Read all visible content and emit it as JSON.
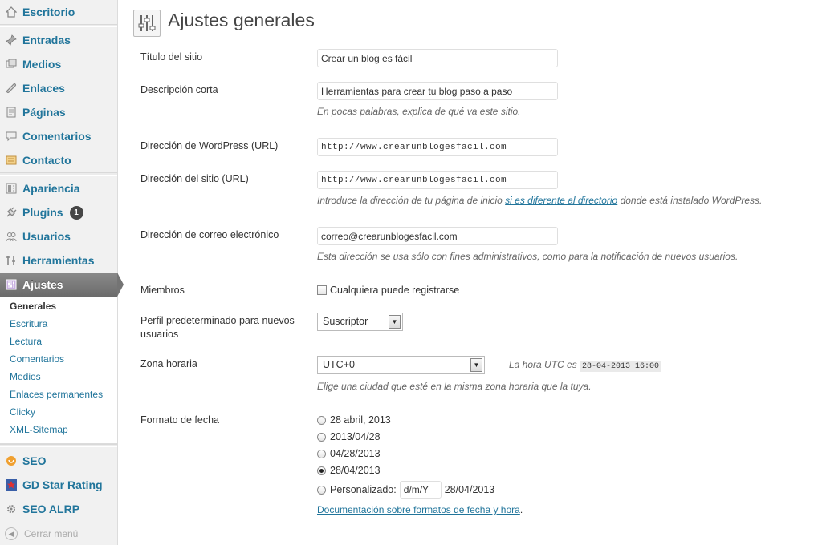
{
  "sidebar": {
    "items": [
      {
        "label": "Escritorio",
        "icon": "home-icon"
      },
      {
        "label": "Entradas",
        "icon": "pin-icon"
      },
      {
        "label": "Medios",
        "icon": "media-icon"
      },
      {
        "label": "Enlaces",
        "icon": "link-icon"
      },
      {
        "label": "Páginas",
        "icon": "page-icon"
      },
      {
        "label": "Comentarios",
        "icon": "comment-icon"
      },
      {
        "label": "Contacto",
        "icon": "contact-icon"
      },
      {
        "label": "Apariencia",
        "icon": "appearance-icon"
      },
      {
        "label": "Plugins",
        "icon": "plugin-icon",
        "badge": "1"
      },
      {
        "label": "Usuarios",
        "icon": "users-icon"
      },
      {
        "label": "Herramientas",
        "icon": "tools-icon"
      },
      {
        "label": "Ajustes",
        "icon": "settings-icon"
      },
      {
        "label": "SEO",
        "icon": "seo-icon"
      },
      {
        "label": "GD Star Rating",
        "icon": "star-icon"
      },
      {
        "label": "SEO ALRP",
        "icon": "gear-icon"
      }
    ],
    "submenu": [
      "Generales",
      "Escritura",
      "Lectura",
      "Comentarios",
      "Medios",
      "Enlaces permanentes",
      "Clicky",
      "XML-Sitemap"
    ],
    "collapse_label": "Cerrar menú"
  },
  "page": {
    "title": "Ajustes generales"
  },
  "form": {
    "site_title": {
      "label": "Título del sitio",
      "value": "Crear un blog es fácil"
    },
    "tagline": {
      "label": "Descripción corta",
      "value": "Herramientas para crear tu blog paso a paso",
      "description": "En pocas palabras, explica de qué va este sitio."
    },
    "wp_url": {
      "label": "Dirección de WordPress (URL)",
      "value": "http://www.crearunblogesfacil.com"
    },
    "site_url": {
      "label": "Dirección del sitio (URL)",
      "value": "http://www.crearunblogesfacil.com",
      "desc_before": "Introduce la dirección de tu página de inicio ",
      "desc_link": "si es diferente al directorio",
      "desc_after": " donde está instalado WordPress."
    },
    "email": {
      "label": "Dirección de correo electrónico",
      "value": "correo@crearunblogesfacil.com",
      "description": "Esta dirección se usa sólo con fines administrativos, como para la notificación de nuevos usuarios."
    },
    "membership": {
      "label": "Miembros",
      "checkbox_label": "Cualquiera puede registrarse",
      "checked": false
    },
    "default_role": {
      "label": "Perfil predeterminado para nuevos usuarios",
      "value": "Suscriptor"
    },
    "timezone": {
      "label": "Zona horaria",
      "value": "UTC+0",
      "utc_text": "La hora UTC es",
      "utc_time": "28-04-2013 16:00",
      "description": "Elige una ciudad que esté en la misma zona horaria que la tuya."
    },
    "date_format": {
      "label": "Formato de fecha",
      "options": [
        "28 abril, 2013",
        "2013/04/28",
        "04/28/2013",
        "28/04/2013"
      ],
      "selected": "28/04/2013",
      "custom_label": "Personalizado:",
      "custom_value": "d/m/Y",
      "custom_preview": "28/04/2013",
      "doc_link": "Documentación sobre formatos de fecha y hora",
      "doc_suffix": "."
    }
  }
}
